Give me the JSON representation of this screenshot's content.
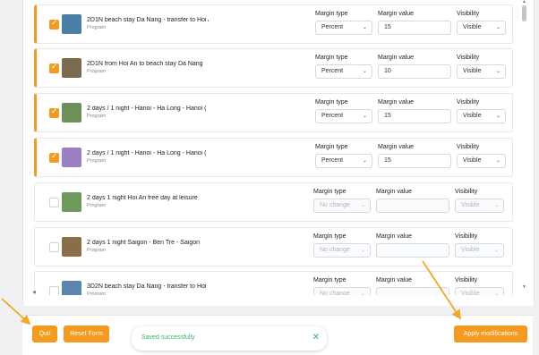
{
  "columns": {
    "margin_type": "Margin type",
    "margin_value": "Margin value",
    "visibility": "Visibility"
  },
  "rows": [
    {
      "name": "2D1N beach stay Da Nang - transfer to Hoi A",
      "type": "Program",
      "selected": true,
      "margin_type": "Percent",
      "margin_value": "15",
      "visibility": "Visible"
    },
    {
      "name": "2D1N from Hoi An to beach stay Da Nang",
      "type": "Program",
      "selected": true,
      "margin_type": "Percent",
      "margin_value": "10",
      "visibility": "Visible"
    },
    {
      "name": "2 days / 1 night - Hanoi - Ha Long - Hanoi (",
      "type": "Program",
      "selected": true,
      "margin_type": "Percent",
      "margin_value": "15",
      "visibility": "Visible"
    },
    {
      "name": "2 days / 1 night - Hanoi - Ha Long - Hanoi (",
      "type": "Program",
      "selected": true,
      "margin_type": "Percent",
      "margin_value": "15",
      "visibility": "Visible"
    },
    {
      "name": "2 days 1 night Hoi An free day at leisure",
      "type": "Program",
      "selected": false,
      "margin_type": "No change",
      "margin_value": "",
      "visibility": "Visible"
    },
    {
      "name": "2 days 1 night Saigon - Ben Tre - Saigon",
      "type": "Program",
      "selected": false,
      "margin_type": "No change",
      "margin_value": "",
      "visibility": "Visible"
    },
    {
      "name": "3D2N beach stay Da Nang - transfer to Hoi",
      "type": "Program",
      "selected": false,
      "margin_type": "No change",
      "margin_value": "",
      "visibility": "Visible"
    }
  ],
  "thumb_colors": [
    "#4a7fa6",
    "#7a6a4e",
    "#6f8f5a",
    "#9b7fc4",
    "#6e9a5d",
    "#8a6e4a",
    "#5b86b0"
  ],
  "footer": {
    "quit_label": "Quit",
    "reset_label": "Reset Form",
    "apply_label": "Apply modifications"
  },
  "toast": {
    "message": "Saved successfully",
    "close_icon": "close-icon"
  },
  "accent_color": "#f39a1f",
  "success_color": "#2fb56a"
}
